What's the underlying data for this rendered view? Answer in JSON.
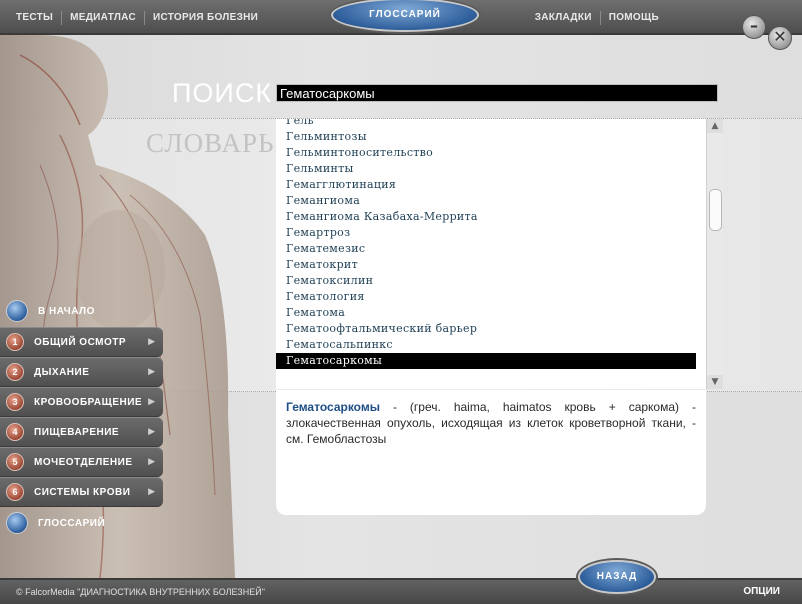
{
  "topbar": {
    "nav_left": [
      "ТЕСТЫ",
      "МЕДИАТЛАС",
      "ИСТОРИЯ БОЛЕЗНИ"
    ],
    "center_button": "ГЛОССАРИЙ",
    "nav_right": [
      "ЗАКЛАДКИ",
      "ПОМОЩЬ"
    ],
    "minimize_icon": "–",
    "close_icon": "✕"
  },
  "search": {
    "title": "ПОИСК",
    "value": "Гематосаркомы"
  },
  "dictionary": {
    "title": "СЛОВАРЬ",
    "items": [
      "Гель",
      "Гельминтозы",
      "Гельминтоносительство",
      "Гельминты",
      "Гемагглютинация",
      "Гемангиома",
      "Гемангиома Казабаха-Меррита",
      "Гемартроз",
      "Гематемезис",
      "Гематокрит",
      "Гематоксилин",
      "Гематология",
      "Гематома",
      "Гематоофтальмический барьер",
      "Гематосальпинкс",
      "Гематосаркомы"
    ],
    "selected_index": 15
  },
  "definition": {
    "term": "Гематосаркомы",
    "text": " - (греч. haima, haimatos кровь + саркома) - злокачественная опухоль, исходящая из клеток кроветворной ткани, - см. Гемобластозы"
  },
  "menu": {
    "home": "В НАЧАЛО",
    "items": [
      {
        "num": "1",
        "label": "ОБЩИЙ ОСМОТР"
      },
      {
        "num": "2",
        "label": "ДЫХАНИЕ"
      },
      {
        "num": "3",
        "label": "КРОВООБРАЩЕНИЕ"
      },
      {
        "num": "4",
        "label": "ПИЩЕВАРЕНИЕ"
      },
      {
        "num": "5",
        "label": "МОЧЕОТДЕЛЕНИЕ"
      },
      {
        "num": "6",
        "label": "СИСТЕМЫ КРОВИ"
      }
    ],
    "glossary": "ГЛОССАРИЙ",
    "arrow_icon": "▶"
  },
  "bottombar": {
    "copyright": "©   FalcorMedia  \"ДИАГНОСТИКА ВНУТРЕННИХ БОЛЕЗНЕЙ\"",
    "back": "НАЗАД",
    "options": "ОПЦИИ"
  },
  "icons": {
    "scroll_up": "▲",
    "scroll_down": "▼"
  }
}
